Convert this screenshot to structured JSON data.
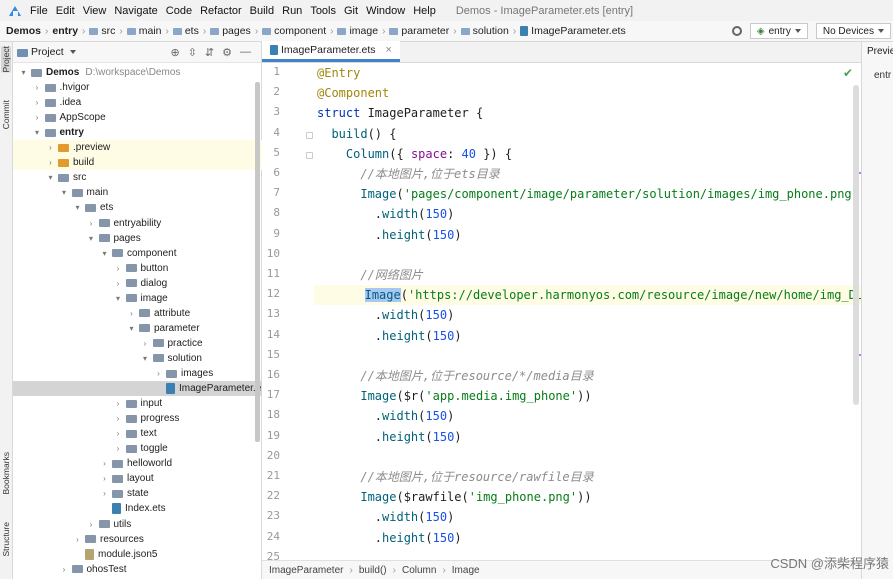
{
  "app": {
    "menu": [
      "File",
      "Edit",
      "View",
      "Navigate",
      "Code",
      "Refactor",
      "Build",
      "Run",
      "Tools",
      "Git",
      "Window",
      "Help"
    ],
    "window_title": "Demos - ImageParameter.ets [entry]"
  },
  "breadcrumb": [
    "Demos",
    "entry",
    "src",
    "main",
    "ets",
    "pages",
    "component",
    "image",
    "parameter",
    "solution",
    "ImageParameter.ets"
  ],
  "toolbar": {
    "run_config": "entry",
    "device": "No Devices"
  },
  "side_labels": [
    "Project",
    "Commit",
    "Bookmarks",
    "Structure"
  ],
  "project": {
    "title": "Project",
    "rows": [
      {
        "label": "Demos",
        "extra": "D:\\workspace\\Demos",
        "depth": 0,
        "arrow": "▾",
        "icon": "folder",
        "bold": true
      },
      {
        "label": ".hvigor",
        "depth": 1,
        "arrow": "›",
        "icon": "folder"
      },
      {
        "label": ".idea",
        "depth": 1,
        "arrow": "›",
        "icon": "folder"
      },
      {
        "label": "AppScope",
        "depth": 1,
        "arrow": "›",
        "icon": "folder"
      },
      {
        "label": "entry",
        "depth": 1,
        "arrow": "▾",
        "icon": "folder",
        "bold": true
      },
      {
        "label": ".preview",
        "depth": 2,
        "arrow": "›",
        "icon": "orange",
        "hl": true
      },
      {
        "label": "build",
        "depth": 2,
        "arrow": "›",
        "icon": "orange",
        "hl": true
      },
      {
        "label": "src",
        "depth": 2,
        "arrow": "▾",
        "icon": "folder"
      },
      {
        "label": "main",
        "depth": 3,
        "arrow": "▾",
        "icon": "folder"
      },
      {
        "label": "ets",
        "depth": 4,
        "arrow": "▾",
        "icon": "folder"
      },
      {
        "label": "entryability",
        "depth": 5,
        "arrow": "›",
        "icon": "folder"
      },
      {
        "label": "pages",
        "depth": 5,
        "arrow": "▾",
        "icon": "folder"
      },
      {
        "label": "component",
        "depth": 6,
        "arrow": "▾",
        "icon": "folder"
      },
      {
        "label": "button",
        "depth": 7,
        "arrow": "›",
        "icon": "folder"
      },
      {
        "label": "dialog",
        "depth": 7,
        "arrow": "›",
        "icon": "folder"
      },
      {
        "label": "image",
        "depth": 7,
        "arrow": "▾",
        "icon": "folder"
      },
      {
        "label": "attribute",
        "depth": 8,
        "arrow": "›",
        "icon": "folder"
      },
      {
        "label": "parameter",
        "depth": 8,
        "arrow": "▾",
        "icon": "folder"
      },
      {
        "label": "practice",
        "depth": 9,
        "arrow": "›",
        "icon": "folder"
      },
      {
        "label": "solution",
        "depth": 9,
        "arrow": "▾",
        "icon": "folder"
      },
      {
        "label": "images",
        "depth": 10,
        "arrow": "›",
        "icon": "folder"
      },
      {
        "label": "ImageParameter.e",
        "depth": 10,
        "arrow": "",
        "icon": "doc",
        "sel": true
      },
      {
        "label": "input",
        "depth": 7,
        "arrow": "›",
        "icon": "folder"
      },
      {
        "label": "progress",
        "depth": 7,
        "arrow": "›",
        "icon": "folder"
      },
      {
        "label": "text",
        "depth": 7,
        "arrow": "›",
        "icon": "folder"
      },
      {
        "label": "toggle",
        "depth": 7,
        "arrow": "›",
        "icon": "folder"
      },
      {
        "label": "helloworld",
        "depth": 6,
        "arrow": "›",
        "icon": "folder"
      },
      {
        "label": "layout",
        "depth": 6,
        "arrow": "›",
        "icon": "folder"
      },
      {
        "label": "state",
        "depth": 6,
        "arrow": "›",
        "icon": "folder"
      },
      {
        "label": "Index.ets",
        "depth": 6,
        "arrow": "",
        "icon": "doc"
      },
      {
        "label": "utils",
        "depth": 5,
        "arrow": "›",
        "icon": "folder"
      },
      {
        "label": "resources",
        "depth": 4,
        "arrow": "›",
        "icon": "folder"
      },
      {
        "label": "module.json5",
        "depth": 4,
        "arrow": "",
        "icon": "json"
      },
      {
        "label": "ohosTest",
        "depth": 3,
        "arrow": "›",
        "icon": "folder"
      }
    ]
  },
  "editor": {
    "tab": "ImageParameter.ets",
    "current_line": 12,
    "lines": [
      [
        [
          "anno",
          "@Entry"
        ]
      ],
      [
        [
          "anno",
          "@Component"
        ]
      ],
      [
        [
          "kw",
          "struct "
        ],
        [
          "",
          "ImageParameter {"
        ]
      ],
      [
        [
          "",
          "  "
        ],
        [
          "fn",
          "build"
        ],
        [
          "",
          "() {"
        ]
      ],
      [
        [
          "",
          "    "
        ],
        [
          "fn",
          "Column"
        ],
        [
          "",
          "({ "
        ],
        [
          "pl",
          "space"
        ],
        [
          "",
          ": "
        ],
        [
          "num",
          "40"
        ],
        [
          "",
          " }) {"
        ]
      ],
      [
        [
          "",
          "      "
        ],
        [
          "cmt",
          "//本地图片,位于ets目录"
        ]
      ],
      [
        [
          "",
          "      "
        ],
        [
          "fn",
          "Image"
        ],
        [
          "",
          "("
        ],
        [
          "str",
          "'pages/component/image/parameter/solution/images/img_phone.png'"
        ],
        [
          "",
          ")"
        ]
      ],
      [
        [
          "",
          "        ."
        ],
        [
          "fn",
          "width"
        ],
        [
          "",
          "("
        ],
        [
          "num",
          "150"
        ],
        [
          "",
          ")"
        ]
      ],
      [
        [
          "",
          "        ."
        ],
        [
          "fn",
          "height"
        ],
        [
          "",
          "("
        ],
        [
          "num",
          "150"
        ],
        [
          "",
          ")"
        ]
      ],
      [],
      [
        [
          "",
          "      "
        ],
        [
          "cmt",
          "//网络图片"
        ]
      ],
      [
        [
          "",
          "      "
        ],
        [
          "fn ihl",
          "Image"
        ],
        [
          "",
          "("
        ],
        [
          "str",
          "'https://developer.harmonyos.com/resource/image/new/home/img_DLI"
        ]
      ],
      [
        [
          "",
          "        ."
        ],
        [
          "fn",
          "width"
        ],
        [
          "",
          "("
        ],
        [
          "num",
          "150"
        ],
        [
          "",
          ")"
        ]
      ],
      [
        [
          "",
          "        ."
        ],
        [
          "fn",
          "height"
        ],
        [
          "",
          "("
        ],
        [
          "num",
          "150"
        ],
        [
          "",
          ")"
        ]
      ],
      [],
      [
        [
          "",
          "      "
        ],
        [
          "cmt",
          "//本地图片,位于resource/*/media目录"
        ]
      ],
      [
        [
          "",
          "      "
        ],
        [
          "fn",
          "Image"
        ],
        [
          "",
          "($r("
        ],
        [
          "str",
          "'app.media.img_phone'"
        ],
        [
          "",
          "))"
        ]
      ],
      [
        [
          "",
          "        ."
        ],
        [
          "fn",
          "width"
        ],
        [
          "",
          "("
        ],
        [
          "num",
          "150"
        ],
        [
          "",
          ")"
        ]
      ],
      [
        [
          "",
          "        ."
        ],
        [
          "fn",
          "height"
        ],
        [
          "",
          "("
        ],
        [
          "num",
          "150"
        ],
        [
          "",
          ")"
        ]
      ],
      [],
      [
        [
          "",
          "      "
        ],
        [
          "cmt",
          "//本地图片,位于resource/rawfile目录"
        ]
      ],
      [
        [
          "",
          "      "
        ],
        [
          "fn",
          "Image"
        ],
        [
          "",
          "($rawfile("
        ],
        [
          "str",
          "'img_phone.png'"
        ],
        [
          "",
          "))"
        ]
      ],
      [
        [
          "",
          "        ."
        ],
        [
          "fn",
          "width"
        ],
        [
          "",
          "("
        ],
        [
          "num",
          "150"
        ],
        [
          "",
          ")"
        ]
      ],
      [
        [
          "",
          "        ."
        ],
        [
          "fn",
          "height"
        ],
        [
          "",
          "("
        ],
        [
          "num",
          "150"
        ],
        [
          "",
          ")"
        ]
      ],
      []
    ],
    "line_numbers": [
      "1",
      "2",
      "3",
      "4",
      "5",
      "6",
      "7",
      "8",
      "9",
      "10",
      "11",
      "12",
      "13",
      "14",
      "15",
      "16",
      "17",
      "18",
      "19",
      "20",
      "21",
      "22",
      "23",
      "24",
      "25"
    ],
    "status_crumbs": [
      "ImageParameter",
      "build()",
      "Column",
      "Image"
    ]
  },
  "right_pane": {
    "title": "Previe",
    "tab": "entr"
  },
  "watermark": "CSDN @添柴程序猿"
}
